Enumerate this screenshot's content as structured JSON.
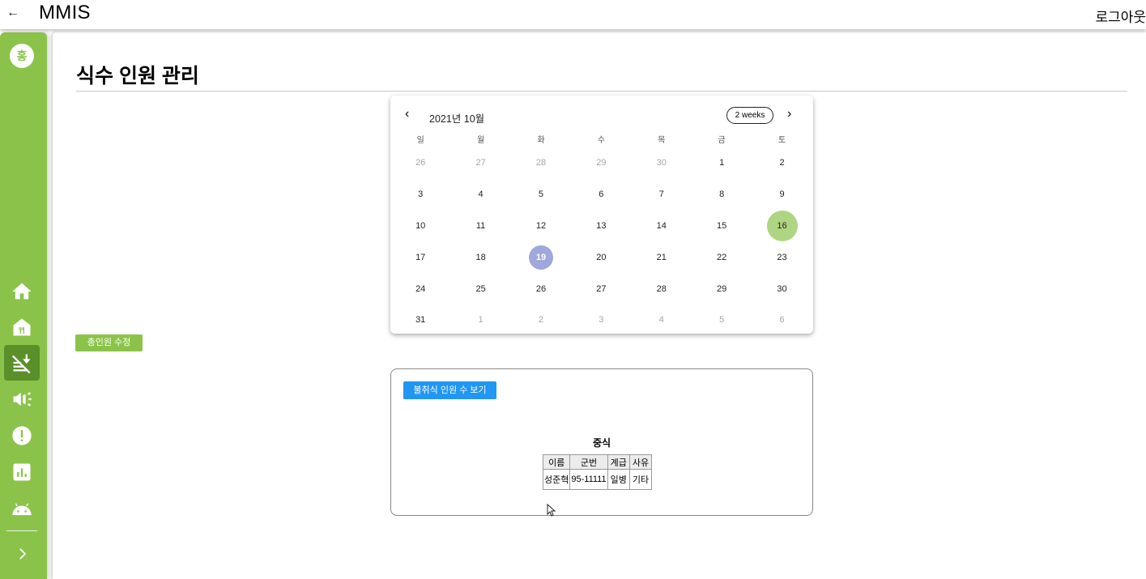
{
  "appbar": {
    "back_icon": "arrow-left-icon",
    "title": "MMIS",
    "logout": "로그아웃"
  },
  "sidebar": {
    "avatar": "홍",
    "items": [
      {
        "name": "home",
        "icon": "home-icon",
        "active": false
      },
      {
        "name": "restaurant",
        "icon": "restaurant-icon",
        "active": false
      },
      {
        "name": "no-meals",
        "icon": "no-meals-icon",
        "active": true
      },
      {
        "name": "announcement",
        "icon": "megaphone-icon",
        "active": false
      },
      {
        "name": "alert",
        "icon": "alert-icon",
        "active": false
      },
      {
        "name": "stats",
        "icon": "bar-chart-icon",
        "active": false
      },
      {
        "name": "android",
        "icon": "android-icon",
        "active": false
      }
    ],
    "expand_icon": "chevron-right-icon"
  },
  "page": {
    "title": "식수 인원 관리"
  },
  "calendar": {
    "month_label": "2021년 10월",
    "format_button": "2 weeks",
    "weekdays": [
      "일",
      "월",
      "화",
      "수",
      "목",
      "금",
      "토"
    ],
    "weeks": [
      [
        {
          "d": "26",
          "out": true
        },
        {
          "d": "27",
          "out": true
        },
        {
          "d": "28",
          "out": true
        },
        {
          "d": "29",
          "out": true
        },
        {
          "d": "30",
          "out": true
        },
        {
          "d": "1"
        },
        {
          "d": "2"
        }
      ],
      [
        {
          "d": "3"
        },
        {
          "d": "4"
        },
        {
          "d": "5"
        },
        {
          "d": "6"
        },
        {
          "d": "7"
        },
        {
          "d": "8"
        },
        {
          "d": "9"
        }
      ],
      [
        {
          "d": "10"
        },
        {
          "d": "11"
        },
        {
          "d": "12"
        },
        {
          "d": "13"
        },
        {
          "d": "14"
        },
        {
          "d": "15"
        },
        {
          "d": "16",
          "today": true
        }
      ],
      [
        {
          "d": "17"
        },
        {
          "d": "18"
        },
        {
          "d": "19",
          "selected": true
        },
        {
          "d": "20"
        },
        {
          "d": "21"
        },
        {
          "d": "22"
        },
        {
          "d": "23"
        }
      ],
      [
        {
          "d": "24"
        },
        {
          "d": "25"
        },
        {
          "d": "26"
        },
        {
          "d": "27"
        },
        {
          "d": "28"
        },
        {
          "d": "29"
        },
        {
          "d": "30"
        }
      ],
      [
        {
          "d": "31"
        },
        {
          "d": "1",
          "out": true
        },
        {
          "d": "2",
          "out": true
        },
        {
          "d": "3",
          "out": true
        },
        {
          "d": "4",
          "out": true
        },
        {
          "d": "5",
          "out": true
        },
        {
          "d": "6",
          "out": true
        }
      ]
    ],
    "colors": {
      "today": "#aed581",
      "selected": "#9fa8da"
    }
  },
  "edit_total_button": "총인원 수정",
  "absent": {
    "button": "불취식 인원 수 보기",
    "meal_title": "중식",
    "headers": [
      "이름",
      "군번",
      "계급",
      "사유"
    ],
    "rows": [
      [
        "성준혁",
        "95-11111",
        "일병",
        "기타"
      ]
    ]
  },
  "colors": {
    "primary": "#8bc34a",
    "primary_dark": "#5a8f2a",
    "blue": "#2196f3"
  }
}
